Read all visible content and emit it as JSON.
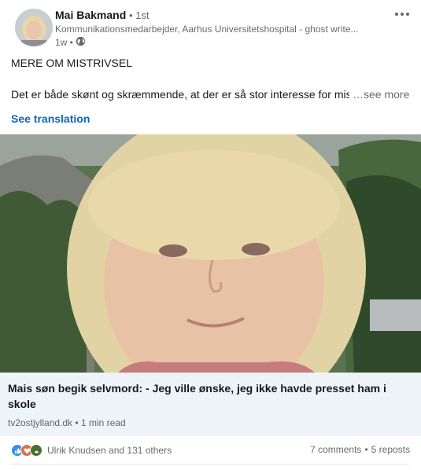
{
  "post": {
    "author": {
      "name": "Mai Bakmand",
      "degree": "• 1st",
      "headline": "Kommunikationsmedarbejder, Aarhus Universitetshospital - ghost write...",
      "time": "1w •",
      "visibility_icon": "globe-icon"
    },
    "title": "MERE OM MISTRIVSEL",
    "body": "Det er både skønt og skræmmende, at der er så stor interesse for mistrivsel",
    "see_more": "…see more",
    "see_translation": "See translation"
  },
  "article": {
    "title": "Mais søn begik selvmord: - Jeg ville ønske, jeg ikke havde presset ham i skole",
    "source": "tv2ostjylland.dk",
    "separator": "•",
    "read_time": "1 min read"
  },
  "social": {
    "reactions_text": "Ulrik Knudsen and 131 others",
    "comments": "7 comments",
    "dot": "•",
    "reposts": "5 reposts",
    "reaction_icons": [
      "like-icon",
      "love-icon",
      "support-icon"
    ],
    "colors": {
      "like": "#378fe9",
      "love": "#df704d",
      "support": "#44712e"
    }
  },
  "colors": {
    "accent": "#0a66c2",
    "card_bg": "#eef3f8"
  }
}
